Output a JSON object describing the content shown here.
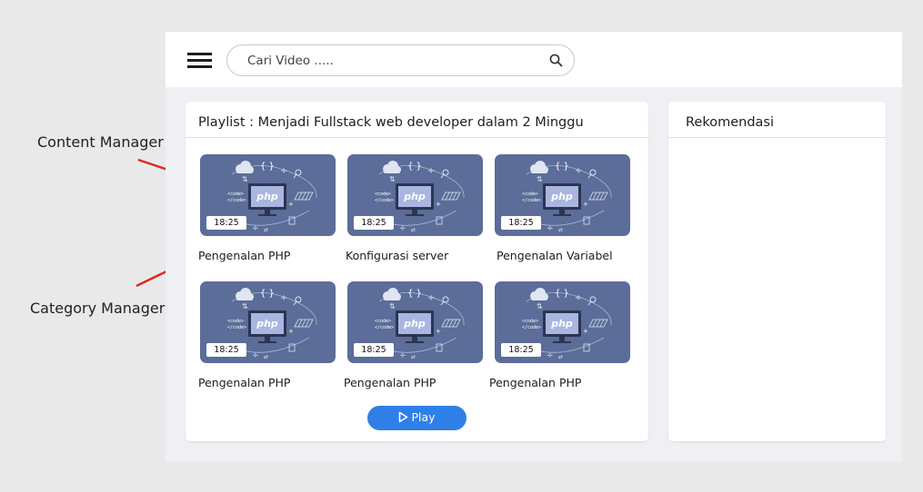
{
  "annotations": {
    "content_manager": "Content Manager",
    "category_manager": "Category Manager"
  },
  "header": {
    "menu_icon": "hamburger-menu-icon",
    "search_placeholder": "Cari Video .....",
    "search_icon": "search-icon"
  },
  "playlist": {
    "title": "Playlist : Menjadi Fullstack web developer dalam 2 Minggu",
    "videos": [
      {
        "title": "Pengenalan PHP",
        "duration": "18:25",
        "thumb_label": "php"
      },
      {
        "title": "Konfigurasi server",
        "duration": "18:25",
        "thumb_label": "php"
      },
      {
        "title": "Pengenalan Variabel",
        "duration": "18:25",
        "thumb_label": "php"
      },
      {
        "title": "Pengenalan PHP",
        "duration": "18:25",
        "thumb_label": "php"
      },
      {
        "title": "Pengenalan PHP",
        "duration": "18:25",
        "thumb_label": "php"
      },
      {
        "title": "Pengenalan PHP",
        "duration": "18:25",
        "thumb_label": "php"
      }
    ],
    "play_label": "Play",
    "play_icon": "play-icon"
  },
  "recommendation": {
    "title": "Rekomendasi"
  },
  "colors": {
    "accent": "#2f7fe9",
    "thumbnail_bg": "#5b6d98",
    "arrow": "#e0261f"
  }
}
